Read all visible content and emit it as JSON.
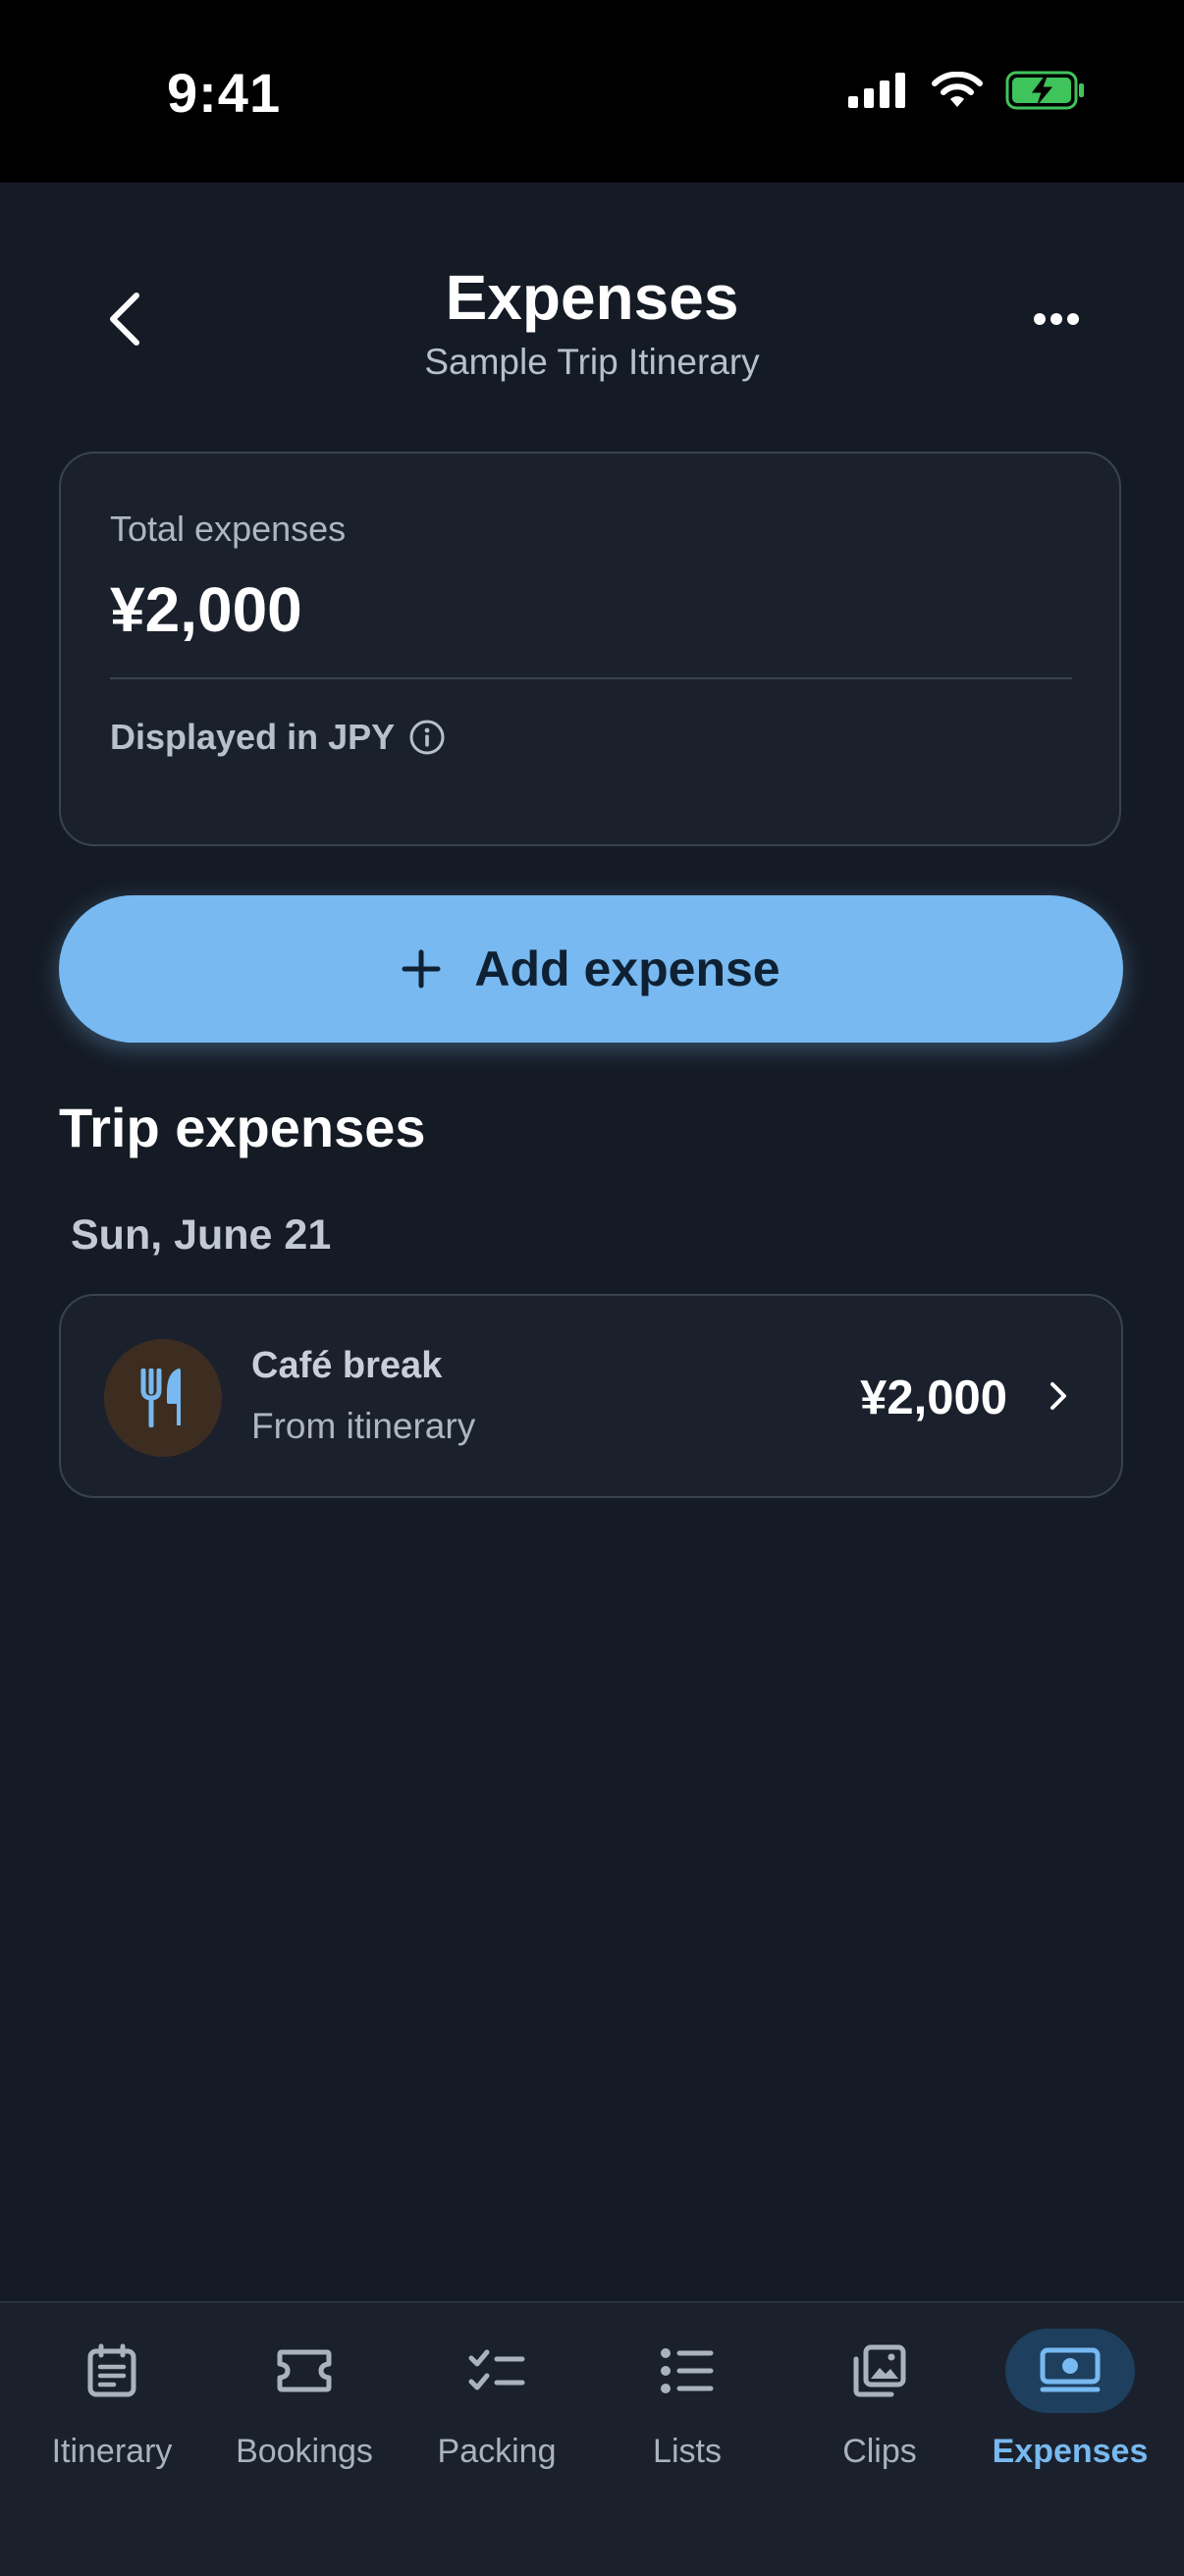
{
  "status_bar": {
    "time": "9:41"
  },
  "header": {
    "title": "Expenses",
    "subtitle": "Sample Trip Itinerary"
  },
  "summary": {
    "label": "Total expenses",
    "total": "¥2,000",
    "currency_note": "Displayed in JPY"
  },
  "add_button": {
    "label": "Add expense"
  },
  "section": {
    "title": "Trip expenses"
  },
  "groups": [
    {
      "date": "Sun, June 21",
      "items": [
        {
          "title": "Café break",
          "source": "From itinerary",
          "amount": "¥2,000",
          "icon": "fork-knife-icon"
        }
      ]
    }
  ],
  "tabs": [
    {
      "label": "Itinerary",
      "icon": "itinerary-icon"
    },
    {
      "label": "Bookings",
      "icon": "ticket-icon"
    },
    {
      "label": "Packing",
      "icon": "checklist-icon"
    },
    {
      "label": "Lists",
      "icon": "list-icon"
    },
    {
      "label": "Clips",
      "icon": "photos-icon"
    },
    {
      "label": "Expenses",
      "icon": "money-icon",
      "active": true
    }
  ],
  "colors": {
    "background": "#151b25",
    "card": "#1b212c",
    "accent": "#77b9f0",
    "battery": "#3fc35b",
    "food_icon_bg": "#3d2d20"
  }
}
